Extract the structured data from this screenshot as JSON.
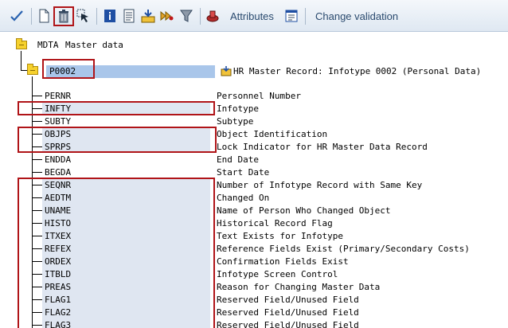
{
  "toolbar": {
    "attributes_label": "Attributes",
    "change_validation_label": "Change validation"
  },
  "tree": {
    "root": {
      "name": "MDTA",
      "description": "Master data"
    },
    "node": {
      "name": "P0002",
      "description": "HR Master Record: Infotype 0002 (Personal Data)"
    },
    "rows": [
      {
        "field": "PERNR",
        "description": "Personnel Number"
      },
      {
        "field": "INFTY",
        "description": "Infotype"
      },
      {
        "field": "SUBTY",
        "description": "Subtype"
      },
      {
        "field": "OBJPS",
        "description": "Object Identification"
      },
      {
        "field": "SPRPS",
        "description": "Lock Indicator for HR Master Data Record"
      },
      {
        "field": "ENDDA",
        "description": "End Date"
      },
      {
        "field": "BEGDA",
        "description": "Start Date"
      },
      {
        "field": "SEQNR",
        "description": "Number of Infotype Record with Same Key"
      },
      {
        "field": "AEDTM",
        "description": "Changed On"
      },
      {
        "field": "UNAME",
        "description": "Name of Person Who Changed Object"
      },
      {
        "field": "HISTO",
        "description": "Historical Record Flag"
      },
      {
        "field": "ITXEX",
        "description": "Text Exists for Infotype"
      },
      {
        "field": "REFEX",
        "description": "Reference Fields Exist (Primary/Secondary Costs)"
      },
      {
        "field": "ORDEX",
        "description": "Confirmation Fields Exist"
      },
      {
        "field": "ITBLD",
        "description": "Infotype Screen Control"
      },
      {
        "field": "PREAS",
        "description": "Reason for Changing Master Data"
      },
      {
        "field": "FLAG1",
        "description": "Reserved Field/Unused Field"
      },
      {
        "field": "FLAG2",
        "description": "Reserved Field/Unused Field"
      },
      {
        "field": "FLAG3",
        "description": "Reserved Field/Unused Field"
      }
    ]
  }
}
